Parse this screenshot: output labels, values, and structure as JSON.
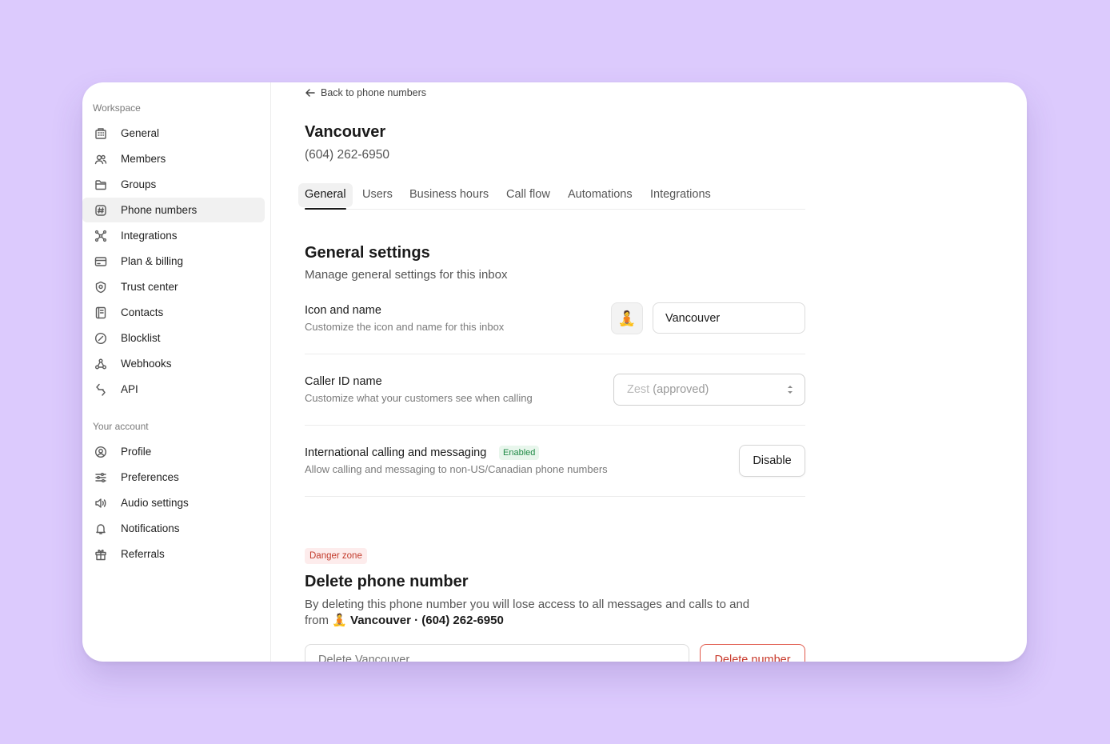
{
  "sidebar": {
    "workspace_label": "Workspace",
    "workspace_items": [
      {
        "label": "General",
        "icon": "building-icon"
      },
      {
        "label": "Members",
        "icon": "users-icon"
      },
      {
        "label": "Groups",
        "icon": "folder-icon"
      },
      {
        "label": "Phone numbers",
        "icon": "hash-icon"
      },
      {
        "label": "Integrations",
        "icon": "integrations-icon"
      },
      {
        "label": "Plan & billing",
        "icon": "credit-card-icon"
      },
      {
        "label": "Trust center",
        "icon": "shield-icon"
      },
      {
        "label": "Contacts",
        "icon": "contacts-icon"
      },
      {
        "label": "Blocklist",
        "icon": "block-icon"
      },
      {
        "label": "Webhooks",
        "icon": "webhook-icon"
      },
      {
        "label": "API",
        "icon": "api-icon"
      }
    ],
    "account_label": "Your account",
    "account_items": [
      {
        "label": "Profile",
        "icon": "profile-icon"
      },
      {
        "label": "Preferences",
        "icon": "sliders-icon"
      },
      {
        "label": "Audio settings",
        "icon": "speaker-icon"
      },
      {
        "label": "Notifications",
        "icon": "bell-icon"
      },
      {
        "label": "Referrals",
        "icon": "gift-icon"
      }
    ],
    "active_item": "Phone numbers"
  },
  "header": {
    "back_label": "Back to phone numbers",
    "title": "Vancouver",
    "phone": "(604) 262-6950"
  },
  "tabs": [
    {
      "label": "General",
      "active": true
    },
    {
      "label": "Users"
    },
    {
      "label": "Business hours"
    },
    {
      "label": "Call flow"
    },
    {
      "label": "Automations"
    },
    {
      "label": "Integrations"
    }
  ],
  "general_settings": {
    "title": "General settings",
    "description": "Manage general settings for this inbox",
    "icon_name": {
      "title": "Icon and name",
      "description": "Customize the icon and name for this inbox",
      "emoji": "🧘",
      "name_value": "Vancouver"
    },
    "caller_id": {
      "title": "Caller ID name",
      "description": "Customize what your customers see when calling",
      "select_name": "Zest",
      "select_suffix": "(approved)"
    },
    "international": {
      "title": "International calling and messaging",
      "badge": "Enabled",
      "description": "Allow calling and messaging to non-US/Canadian phone numbers",
      "button": "Disable"
    }
  },
  "danger_zone": {
    "badge": "Danger zone",
    "title": "Delete phone number",
    "description_line1": "By deleting this phone number you will lose access to all messages and calls to and",
    "description_from": "from",
    "emoji": "🧘",
    "description_target": "Vancouver · (604) 262-6950",
    "input_placeholder": "Delete Vancouver",
    "button": "Delete number"
  },
  "colors": {
    "background": "#dccafd",
    "danger": "#c8392b",
    "success": "#1f8a45"
  }
}
